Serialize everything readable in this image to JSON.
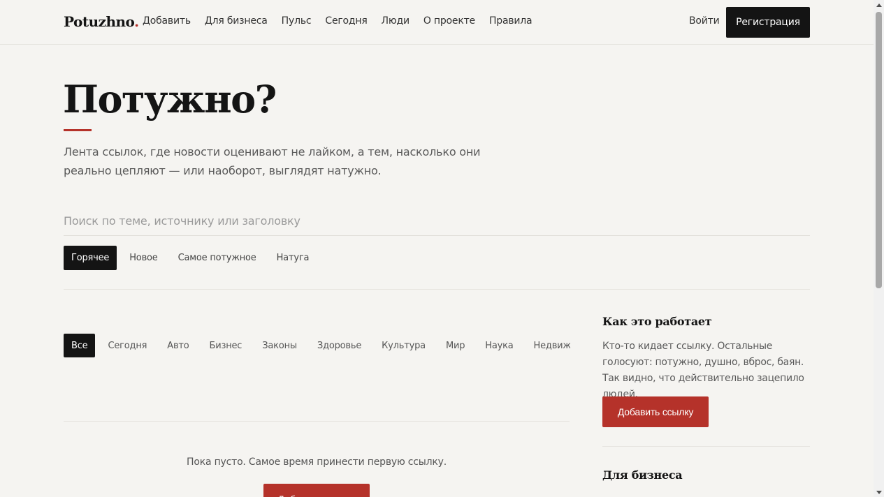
{
  "header": {
    "logo_text": "Potuzhno",
    "logo_dot": ".",
    "nav": [
      "Добавить",
      "Для бизнеса",
      "Пульс",
      "Сегодня",
      "Люди",
      "О проекте",
      "Правила"
    ],
    "login_label": "Войти",
    "register_label": "Регистрация"
  },
  "hero": {
    "title": "Потужно?",
    "subtitle": "Лента ссылок, где новости оценивают не лайком, а тем, насколько они реально цепляют — или наоборот, выглядят натужно."
  },
  "search": {
    "placeholder": "Поиск по теме, источнику или заголовку",
    "value": ""
  },
  "sort_tabs": [
    {
      "label": "Горячее",
      "active": true
    },
    {
      "label": "Новое",
      "active": false
    },
    {
      "label": "Самое потужное",
      "active": false
    },
    {
      "label": "Натуга",
      "active": false
    }
  ],
  "categories": [
    {
      "label": "Все",
      "active": true
    },
    {
      "label": "Сегодня",
      "active": false
    },
    {
      "label": "Авто",
      "active": false
    },
    {
      "label": "Бизнес",
      "active": false
    },
    {
      "label": "Законы",
      "active": false
    },
    {
      "label": "Здоровье",
      "active": false
    },
    {
      "label": "Культура",
      "active": false
    },
    {
      "label": "Мир",
      "active": false
    },
    {
      "label": "Наука",
      "active": false
    },
    {
      "label": "Недвижимость",
      "active": false
    }
  ],
  "feed": {
    "empty_text": "Пока пусто. Самое время принести первую ссылку.",
    "empty_button": "Добавить ссылку"
  },
  "sidebar": {
    "how_title": "Как это работает",
    "how_text": "Кто-то кидает ссылку. Остальные голосуют: потужно, душно, вброс, баян. Так видно, что действительно зацепило людей.",
    "add_button": "Добавить ссылку",
    "business_title": "Для бизнеса"
  },
  "colors": {
    "accent": "#b5322a",
    "dark": "#141414",
    "background": "#f5f4f1"
  }
}
